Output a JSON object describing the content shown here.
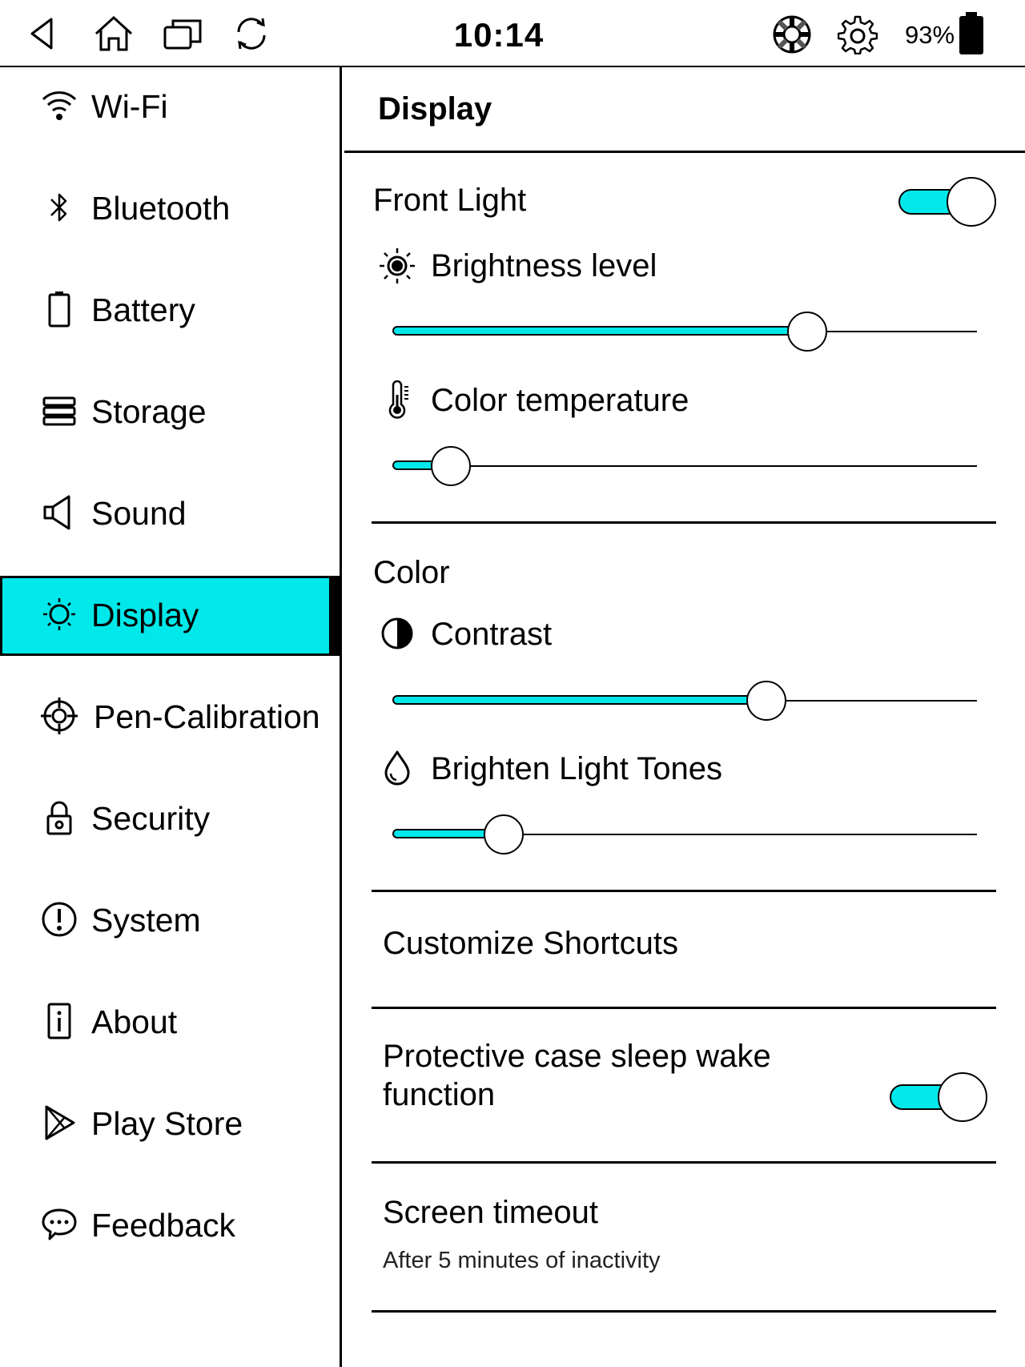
{
  "status_bar": {
    "time": "10:14",
    "battery_percent": "93%",
    "icons": [
      "back-icon",
      "home-icon",
      "recent-apps-icon",
      "refresh-icon",
      "lifebuoy-icon",
      "gear-icon",
      "battery-icon"
    ]
  },
  "sidebar": {
    "items": [
      {
        "label": "Wi-Fi",
        "icon": "wifi-icon"
      },
      {
        "label": "Bluetooth",
        "icon": "bluetooth-icon"
      },
      {
        "label": "Battery",
        "icon": "battery-icon"
      },
      {
        "label": "Storage",
        "icon": "storage-icon"
      },
      {
        "label": "Sound",
        "icon": "speaker-icon"
      },
      {
        "label": "Display",
        "icon": "sun-icon",
        "active": true
      },
      {
        "label": "Pen-Calibration",
        "icon": "crosshair-icon"
      },
      {
        "label": "Security",
        "icon": "lock-icon"
      },
      {
        "label": "System",
        "icon": "exclamation-circle-icon"
      },
      {
        "label": "About",
        "icon": "info-icon"
      },
      {
        "label": "Play Store",
        "icon": "play-store-icon"
      },
      {
        "label": "Feedback",
        "icon": "chat-bubble-icon"
      }
    ]
  },
  "main": {
    "title": "Display",
    "front_light": {
      "label": "Front Light",
      "enabled": true,
      "brightness": {
        "label": "Brightness level",
        "value": 0.71
      },
      "color_temperature": {
        "label": "Color temperature",
        "value": 0.1
      }
    },
    "color": {
      "label": "Color",
      "contrast": {
        "label": "Contrast",
        "value": 0.64
      },
      "brighten_light_tones": {
        "label": "Brighten Light Tones",
        "value": 0.19
      }
    },
    "customize_shortcuts": {
      "label": "Customize Shortcuts"
    },
    "protective_case": {
      "label_line1": "Protective case sleep wake",
      "label_line2": "function",
      "enabled": true
    },
    "screen_timeout": {
      "label": "Screen timeout",
      "sub": "After 5 minutes of inactivity"
    }
  },
  "colors": {
    "accent": "#00e8ea",
    "foreground": "#000000",
    "background": "#ffffff"
  }
}
